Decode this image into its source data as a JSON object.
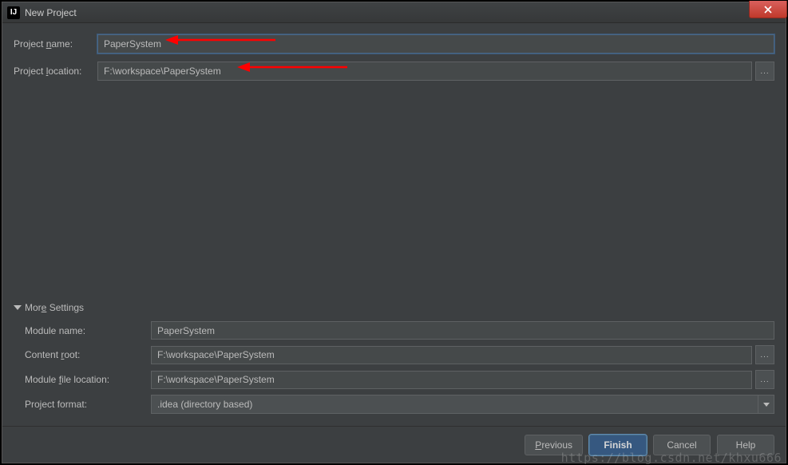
{
  "window": {
    "title": "New Project",
    "appicon_text": "IJ"
  },
  "fields": {
    "project_name_label": "Project name:",
    "project_name_value": "PaperSystem",
    "project_location_label": "Project location:",
    "project_location_value": "F:\\workspace\\PaperSystem",
    "browse_ellipsis": "..."
  },
  "more_settings": {
    "header": "More Settings",
    "module_name_label": "Module name:",
    "module_name_value": "PaperSystem",
    "content_root_label": "Content root:",
    "content_root_value": "F:\\workspace\\PaperSystem",
    "module_file_location_label": "Module file location:",
    "module_file_location_value": "F:\\workspace\\PaperSystem",
    "project_format_label": "Project format:",
    "project_format_value": ".idea (directory based)"
  },
  "buttons": {
    "previous": "Previous",
    "finish": "Finish",
    "cancel": "Cancel",
    "help": "Help"
  },
  "watermark": "https://blog.csdn.net/khxu666",
  "colors": {
    "bg": "#3c3f41",
    "input_bg": "#45494a",
    "border": "#5e6163",
    "primary": "#365880",
    "annotation": "#ff0000"
  }
}
